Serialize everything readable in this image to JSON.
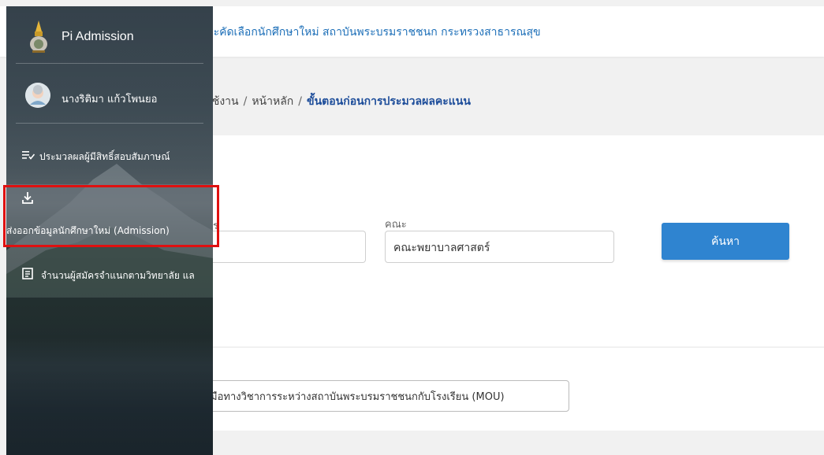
{
  "header": {
    "title": "ละคัดเลือกนักศึกษาใหม่ สถาบันพระบรมราชชนก กระทรวงสาธารณสุข"
  },
  "breadcrumb": {
    "items": [
      "ใช้งาน",
      "หน้าหลัก"
    ],
    "separator": "/",
    "current": "ขั้นตอนก่อนการประมวลผลคะแนน"
  },
  "filters": {
    "partial_label": "ร",
    "faculty_label": "คณะ",
    "faculty_value": "คณะพยาบาลศาสตร์",
    "search_label": "ค้นหา"
  },
  "mou": {
    "button_label": "มือทางวิชาการระหว่างสถาบันพระบรมราชชนกกับโรงเรียน (MOU)"
  },
  "sidebar": {
    "brand": "Pi Admission",
    "user": "นางริติมา แก้วโพนยอ",
    "items": [
      {
        "label": "ประมวลผลผู้มีสิทธิ์สอบสัมภาษณ์",
        "icon": "list-check-icon"
      },
      {
        "label": "ส่งออกข้อมูลนักศึกษาใหม่ (Admission)",
        "icon": "download-icon",
        "active": true
      },
      {
        "label": "จำนวนผู้สมัครจำแนกตามวิทยาลัย แล",
        "icon": "document-icon"
      }
    ]
  },
  "colors": {
    "accent": "#2f84d0",
    "highlight": "#e01010",
    "header_text": "#1d6fb8"
  }
}
